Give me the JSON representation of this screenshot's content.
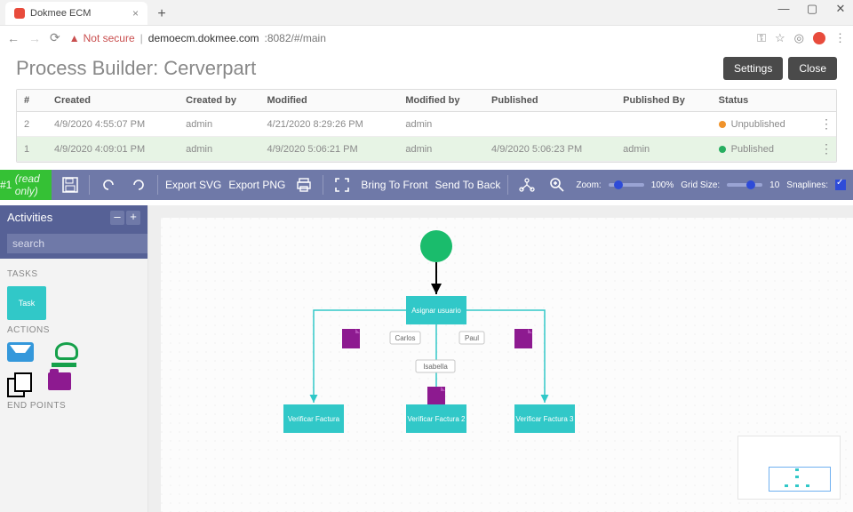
{
  "browser": {
    "tab_title": "Dokmee ECM",
    "not_secure": "Not secure",
    "url_host": "demoecm.dokmee.com",
    "url_rest": ":8082/#/main"
  },
  "header": {
    "title": "Process Builder: Cerverpart",
    "settings": "Settings",
    "close": "Close"
  },
  "table": {
    "cols": {
      "num": "#",
      "created": "Created",
      "created_by": "Created by",
      "modified": "Modified",
      "modified_by": "Modified by",
      "published": "Published",
      "published_by": "Published By",
      "status": "Status"
    },
    "rows": [
      {
        "num": "2",
        "created": "4/9/2020 4:55:07 PM",
        "created_by": "admin",
        "modified": "4/21/2020 8:29:26 PM",
        "modified_by": "admin",
        "published": "",
        "published_by": "",
        "status": "Unpublished",
        "status_cls": "orange"
      },
      {
        "num": "1",
        "created": "4/9/2020 4:09:01 PM",
        "created_by": "admin",
        "modified": "4/9/2020 5:06:21 PM",
        "modified_by": "admin",
        "published": "4/9/2020 5:06:23 PM",
        "published_by": "admin",
        "status": "Published",
        "status_cls": "green"
      }
    ]
  },
  "banner": {
    "num": "#1",
    "readonly": "(read only)"
  },
  "toolbar": {
    "export_svg": "Export SVG",
    "export_png": "Export PNG",
    "bring_front": "Bring To Front",
    "send_back": "Send To Back",
    "zoom_label": "Zoom:",
    "zoom_value": "100%",
    "grid_label": "Grid Size:",
    "grid_value": "10",
    "snap_label": "Snaplines:"
  },
  "sidebar": {
    "activities": "Activities",
    "search_placeholder": "search",
    "tasks": "TASKS",
    "task_label": "Task",
    "actions": "ACTIONS",
    "endpoints": "END POINTS"
  },
  "nodes": {
    "assign": "Asignar usuario",
    "v1": "Verificar Factura",
    "v2": "Verificar Factura 2",
    "v3": "Verificar Factura 3",
    "carlos": "Carlos",
    "paul": "Paul",
    "isabella": "Isabella"
  }
}
